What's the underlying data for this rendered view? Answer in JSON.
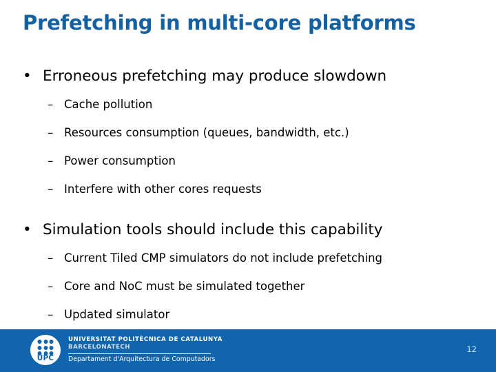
{
  "slide": {
    "title": "Prefetching in multi-core platforms",
    "title_color": "#1560a0",
    "background_color": "#ffffff",
    "text_color": "#000000"
  },
  "content": {
    "bullet_marker": "•",
    "sub_bullet_marker": "–",
    "groups": [
      {
        "heading": "Erroneous prefetching may produce slowdown",
        "items": [
          "Cache pollution",
          "Resources consumption (queues, bandwidth, etc.)",
          "Power consumption",
          "Interfere with other cores requests"
        ]
      },
      {
        "heading": "Simulation tools should include this capability",
        "items": [
          "Current Tiled CMP simulators do not include prefetching",
          "Core and NoC must be simulated together",
          "Updated simulator"
        ]
      }
    ]
  },
  "footer": {
    "background_color": "#1165ac",
    "logo": {
      "mark_word": "UPC",
      "line1": "UNIVERSITAT POLITÈCNICA DE CATALUNYA",
      "line2": "BARCELONATECH",
      "line3": "Departament d'Arquitectura de Computadors"
    },
    "page_number": "12"
  }
}
